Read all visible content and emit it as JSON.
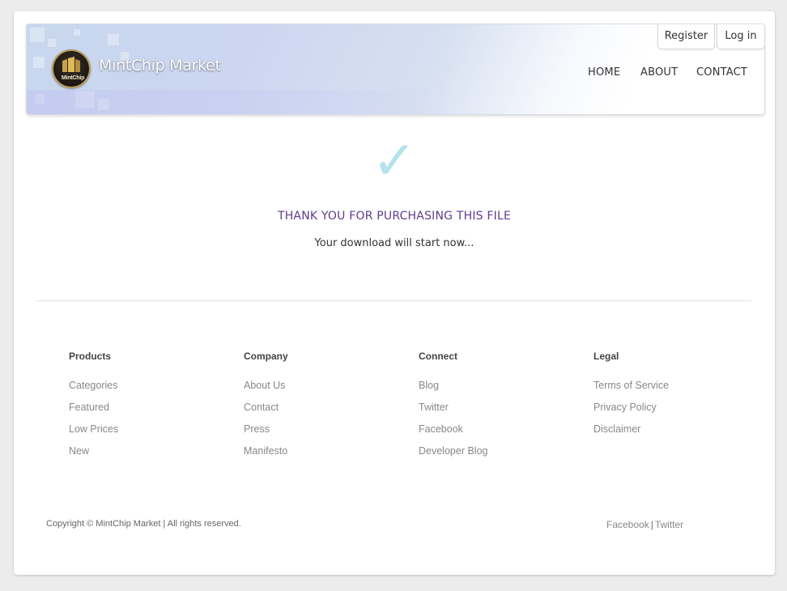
{
  "header": {
    "logo_text": "MintChip",
    "site_title": "MintChip Market",
    "auth": {
      "register": "Register",
      "login": "Log in"
    },
    "nav": {
      "home": "HOME",
      "about": "ABOUT",
      "contact": "CONTACT"
    }
  },
  "main": {
    "check_glyph": "✓",
    "heading": "THANK YOU FOR PURCHASING THIS FILE",
    "subtext": "Your download will start now..."
  },
  "footer": {
    "columns": [
      {
        "title": "Products",
        "links": [
          "Categories",
          "Featured",
          "Low Prices",
          "New"
        ]
      },
      {
        "title": "Company",
        "links": [
          "About Us",
          "Contact",
          "Press",
          "Manifesto"
        ]
      },
      {
        "title": "Connect",
        "links": [
          "Blog",
          "Twitter",
          "Facebook",
          "Developer Blog"
        ]
      },
      {
        "title": "Legal",
        "links": [
          "Terms of Service",
          "Privacy Policy",
          "Disclaimer"
        ]
      }
    ],
    "copyright": "Copyright © MintChip Market | All rights reserved.",
    "social": {
      "facebook": "Facebook",
      "separator": "|",
      "twitter": "Twitter"
    }
  },
  "colors": {
    "accent_heading": "#5e3c8e",
    "checkmark": "#b4e2ee",
    "link_gray": "#888888"
  }
}
